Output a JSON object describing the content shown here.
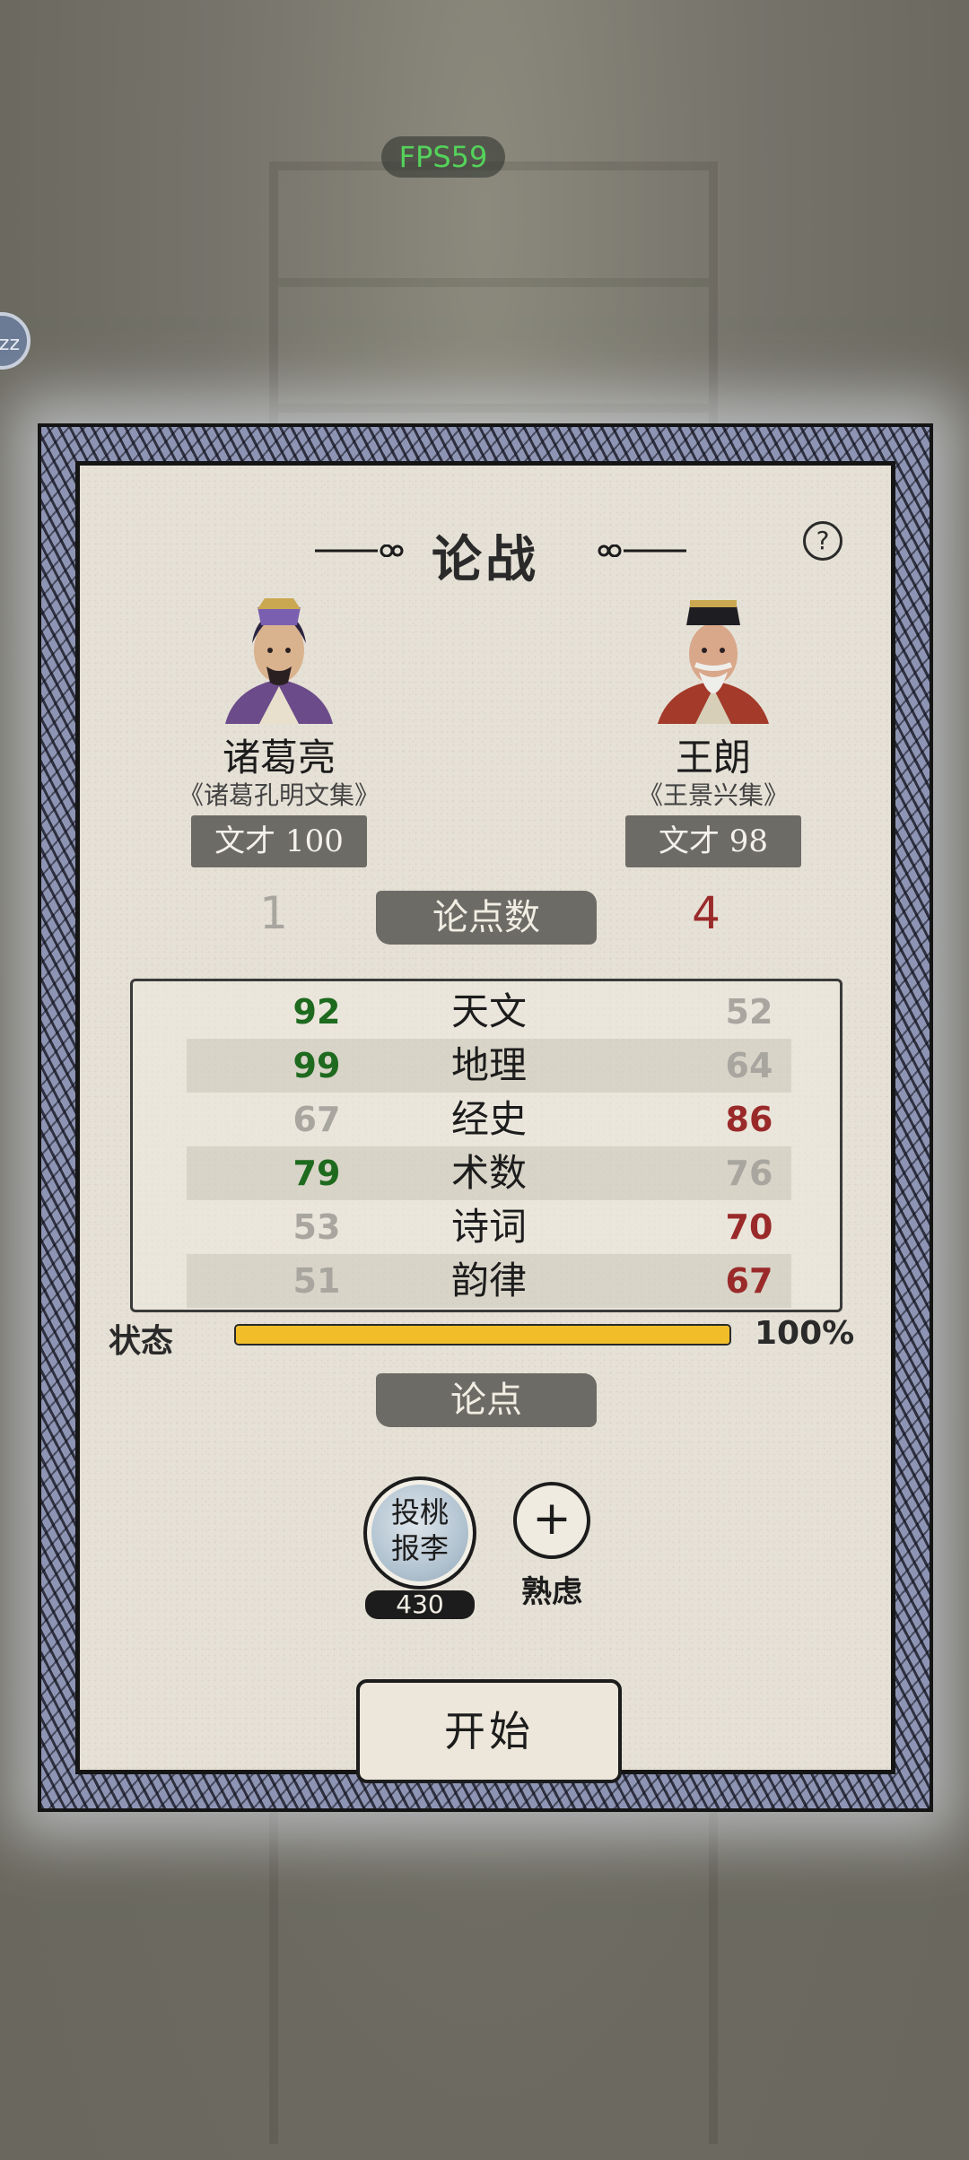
{
  "fps": "FPS59",
  "side_badge": "zz",
  "dialog": {
    "title": "论战",
    "help": "?"
  },
  "left": {
    "name": "诸葛亮",
    "book": "《诸葛孔明文集》",
    "talent_label": "文才 100",
    "points": "1"
  },
  "right": {
    "name": "王朗",
    "book": "《王景兴集》",
    "talent_label": "文才 98",
    "points": "4"
  },
  "points_banner": "论点数",
  "stats": [
    {
      "left": "92",
      "name": "天文",
      "right": "52",
      "left_color": "green",
      "right_color": "grey"
    },
    {
      "left": "99",
      "name": "地理",
      "right": "64",
      "left_color": "green",
      "right_color": "grey"
    },
    {
      "left": "67",
      "name": "经史",
      "right": "86",
      "left_color": "grey",
      "right_color": "red"
    },
    {
      "left": "79",
      "name": "术数",
      "right": "76",
      "left_color": "green",
      "right_color": "grey"
    },
    {
      "left": "53",
      "name": "诗词",
      "right": "70",
      "left_color": "grey",
      "right_color": "red"
    },
    {
      "left": "51",
      "name": "韵律",
      "right": "67",
      "left_color": "grey",
      "right_color": "red"
    }
  ],
  "state": {
    "label": "状态",
    "percent_text": "100%",
    "value": 1.0
  },
  "argument_banner": "论点",
  "skill": {
    "name_line1": "投桃",
    "name_line2": "报李",
    "cost": "430"
  },
  "ponder": {
    "symbol": "+",
    "label": "熟虑"
  },
  "start_button": "开始",
  "colors": {
    "green": "#1e6a1e",
    "red": "#9a2a2a",
    "grey": "#a8a69f",
    "bar_fill": "#f1be2a",
    "frame": "#8e95b4",
    "paper": "#e6e1d6"
  }
}
